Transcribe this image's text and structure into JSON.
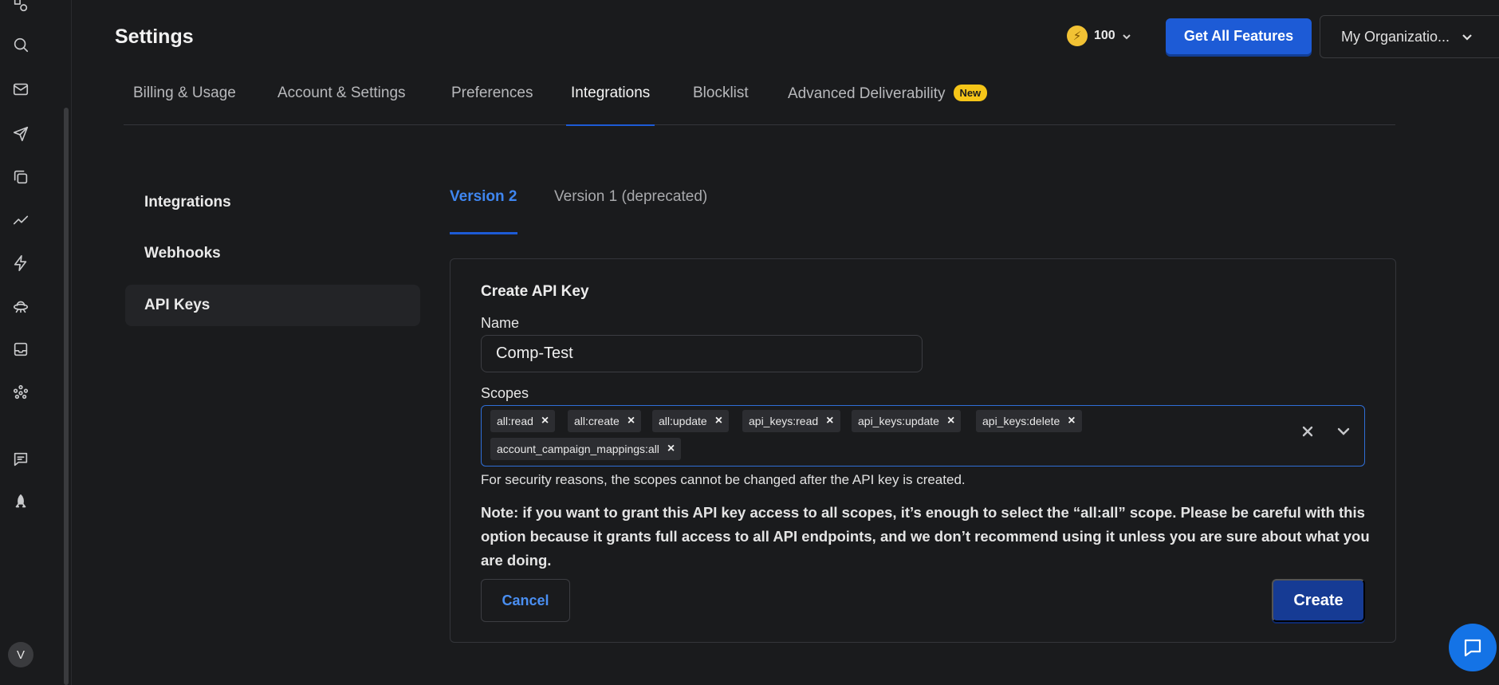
{
  "header": {
    "title": "Settings",
    "credits": "100",
    "get_features_label": "Get All Features",
    "org_name": "My Organizatio..."
  },
  "tabs": [
    {
      "label": "Billing & Usage"
    },
    {
      "label": "Account & Settings"
    },
    {
      "label": "Preferences"
    },
    {
      "label": "Integrations",
      "active": true
    },
    {
      "label": "Blocklist"
    },
    {
      "label": "Advanced Deliverability",
      "badge": "New"
    }
  ],
  "sidenav": [
    {
      "label": "Integrations"
    },
    {
      "label": "Webhooks"
    },
    {
      "label": "API Keys",
      "active": true
    }
  ],
  "version_tabs": [
    {
      "label": "Version 2",
      "active": true
    },
    {
      "label": "Version 1 (deprecated)"
    }
  ],
  "form": {
    "title": "Create API Key",
    "name_label": "Name",
    "name_value": "Comp-Test",
    "scopes_label": "Scopes",
    "scopes": [
      "all:read",
      "all:create",
      "all:update",
      "api_keys:read",
      "api_keys:update",
      "api_keys:delete",
      "account_campaign_mappings:all"
    ],
    "help_text": "For security reasons, the scopes cannot be changed after the API key is created.",
    "note": "Note: if you want to grant this API key access to all scopes, it’s enough to select the “all:all” scope. Please be careful with this option because it grants full access to all API endpoints, and we don’t recommend using it unless you are sure about what you are doing.",
    "cancel_label": "Cancel",
    "create_label": "Create"
  },
  "user": {
    "avatar_initial": "V"
  },
  "colors": {
    "background": "#1a1b1d",
    "primary": "#1d5bd6",
    "create_button": "#163b94",
    "link": "#3f86f0",
    "badge": "#f5c518"
  }
}
